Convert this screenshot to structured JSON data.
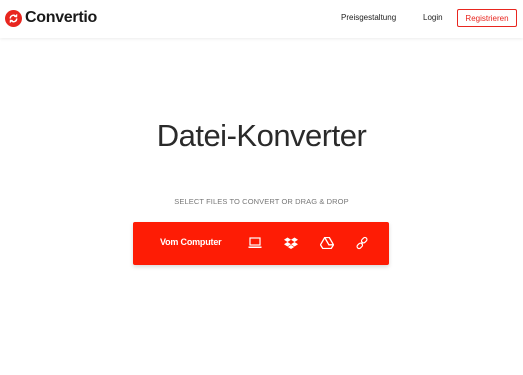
{
  "header": {
    "logo_text": "Convertio",
    "nav": {
      "pricing": "Preisgestaltung",
      "login": "Login",
      "register": "Registrieren"
    }
  },
  "hero": {
    "title": "Datei-Konverter",
    "subtitle": "SELECT FILES TO CONVERT OR DRAG & DROP"
  },
  "upload": {
    "label": "Vom Computer",
    "sources": [
      "computer-icon",
      "dropbox-icon",
      "google-drive-icon",
      "url-link-icon"
    ]
  },
  "colors": {
    "accent": "#e8261f",
    "upload_bg": "#fe1c05",
    "title": "#2a2a2a",
    "subtitle": "#777777"
  }
}
